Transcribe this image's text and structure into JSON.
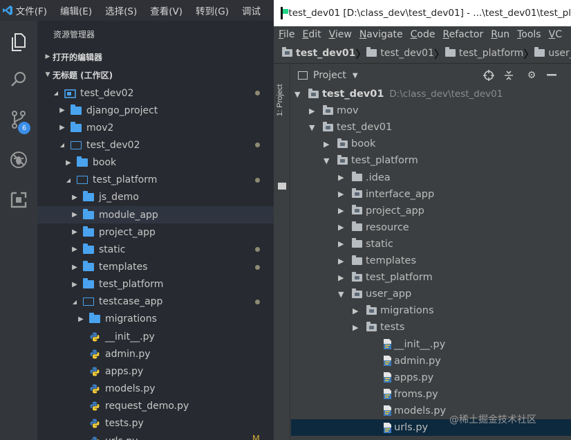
{
  "vscode": {
    "menu": [
      "文件(F)",
      "编辑(E)",
      "选择(S)",
      "查看(V)",
      "转到(G)",
      "调试"
    ],
    "sidebar_title": "资源管理器",
    "section_open_editors": "打开的编辑器",
    "section_workspace": "无标题 (工作区)",
    "scm_badge": "6",
    "tree": [
      {
        "label": "test_dev02",
        "depth": 0,
        "chev": "down",
        "icon": "workspace",
        "dot": true
      },
      {
        "label": "django_project",
        "depth": 1,
        "chev": "right",
        "icon": "folder"
      },
      {
        "label": "mov2",
        "depth": 1,
        "chev": "right",
        "icon": "folder"
      },
      {
        "label": "test_dev02",
        "depth": 1,
        "chev": "down",
        "icon": "folder-open",
        "dot": true
      },
      {
        "label": "book",
        "depth": 2,
        "chev": "right",
        "icon": "folder"
      },
      {
        "label": "test_platform",
        "depth": 2,
        "chev": "down",
        "icon": "folder-open",
        "dot": true
      },
      {
        "label": "js_demo",
        "depth": 3,
        "chev": "right",
        "icon": "folder"
      },
      {
        "label": "module_app",
        "depth": 3,
        "chev": "right",
        "icon": "folder",
        "selected": true
      },
      {
        "label": "project_app",
        "depth": 3,
        "chev": "right",
        "icon": "folder"
      },
      {
        "label": "static",
        "depth": 3,
        "chev": "right",
        "icon": "folder",
        "dot": true
      },
      {
        "label": "templates",
        "depth": 3,
        "chev": "right",
        "icon": "folder",
        "dot": true
      },
      {
        "label": "test_platform",
        "depth": 3,
        "chev": "right",
        "icon": "folder"
      },
      {
        "label": "testcase_app",
        "depth": 3,
        "chev": "down",
        "icon": "folder-open",
        "dot": true
      },
      {
        "label": "migrations",
        "depth": 4,
        "chev": "right",
        "icon": "folder"
      },
      {
        "label": "__init__.py",
        "depth": 4,
        "chev": "",
        "icon": "python"
      },
      {
        "label": "admin.py",
        "depth": 4,
        "chev": "",
        "icon": "python"
      },
      {
        "label": "apps.py",
        "depth": 4,
        "chev": "",
        "icon": "python"
      },
      {
        "label": "models.py",
        "depth": 4,
        "chev": "",
        "icon": "python"
      },
      {
        "label": "request_demo.py",
        "depth": 4,
        "chev": "",
        "icon": "python"
      },
      {
        "label": "tests.py",
        "depth": 4,
        "chev": "",
        "icon": "python"
      },
      {
        "label": "urls.py",
        "depth": 4,
        "chev": "",
        "icon": "python",
        "flag": "M"
      }
    ]
  },
  "pycharm": {
    "title": "test_dev01 [D:\\class_dev\\test_dev01] - ...\\test_dev01\\test_pl",
    "menu": [
      {
        "first": "F",
        "rest": "ile"
      },
      {
        "first": "E",
        "rest": "dit"
      },
      {
        "first": "V",
        "rest": "iew"
      },
      {
        "first": "N",
        "rest": "avigate"
      },
      {
        "first": "C",
        "rest": "ode"
      },
      {
        "first": "R",
        "rest": "efactor"
      },
      {
        "first": "R",
        "rest": "un"
      },
      {
        "first": "T",
        "rest": "ools"
      },
      {
        "first": "V",
        "rest": "C"
      }
    ],
    "breadcrumb": [
      "test_dev01",
      "test_dev01",
      "test_platform",
      "user_ap"
    ],
    "side_tab": "1: Project",
    "panel_label": "Project",
    "tree": [
      {
        "label": "test_dev01",
        "path": "D:\\class_dev\\test_dev01",
        "depth": 0,
        "chev": "down",
        "icon": "folder-dark",
        "bold": true
      },
      {
        "label": "mov",
        "depth": 1,
        "chev": "right",
        "icon": "folder-dark"
      },
      {
        "label": "test_dev01",
        "depth": 1,
        "chev": "down",
        "icon": "folder-dark"
      },
      {
        "label": "book",
        "depth": 2,
        "chev": "right",
        "icon": "folder-dark"
      },
      {
        "label": "test_platform",
        "depth": 2,
        "chev": "down",
        "icon": "folder-dark"
      },
      {
        "label": ".idea",
        "depth": 3,
        "chev": "right",
        "icon": "folder"
      },
      {
        "label": "interface_app",
        "depth": 3,
        "chev": "right",
        "icon": "folder-dark"
      },
      {
        "label": "project_app",
        "depth": 3,
        "chev": "right",
        "icon": "folder-dark"
      },
      {
        "label": "resource",
        "depth": 3,
        "chev": "right",
        "icon": "folder"
      },
      {
        "label": "static",
        "depth": 3,
        "chev": "right",
        "icon": "folder"
      },
      {
        "label": "templates",
        "depth": 3,
        "chev": "right",
        "icon": "folder"
      },
      {
        "label": "test_platform",
        "depth": 3,
        "chev": "right",
        "icon": "folder-dark"
      },
      {
        "label": "user_app",
        "depth": 3,
        "chev": "down",
        "icon": "folder-dark"
      },
      {
        "label": "migrations",
        "depth": 4,
        "chev": "right",
        "icon": "folder-dark"
      },
      {
        "label": "tests",
        "depth": 4,
        "chev": "right",
        "icon": "folder-dark"
      },
      {
        "label": "__init__.py",
        "depth": 5,
        "chev": "",
        "icon": "python"
      },
      {
        "label": "admin.py",
        "depth": 5,
        "chev": "",
        "icon": "python"
      },
      {
        "label": "apps.py",
        "depth": 5,
        "chev": "",
        "icon": "python"
      },
      {
        "label": "froms.py",
        "depth": 5,
        "chev": "",
        "icon": "python"
      },
      {
        "label": "models.py",
        "depth": 5,
        "chev": "",
        "icon": "python"
      },
      {
        "label": "urls.py",
        "depth": 5,
        "chev": "",
        "icon": "python",
        "selected": true
      }
    ]
  },
  "watermark": "@稀土掘金技术社区",
  "colors": {
    "vsc_accent": "#4aa3ef",
    "pc_selection": "#0d293e",
    "badge": "#3c8ee8"
  }
}
